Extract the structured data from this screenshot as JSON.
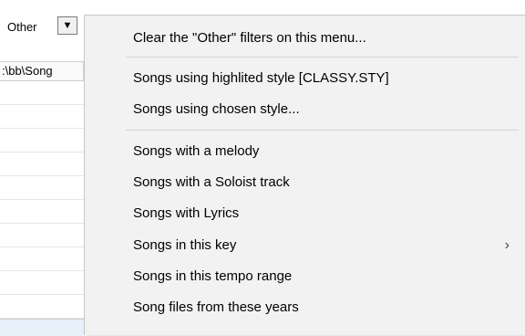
{
  "background": {
    "label": "Other",
    "dropdown_glyph": "▼",
    "path_text": ":\\bb\\Song"
  },
  "menu": {
    "items": [
      {
        "label": "Clear the \"Other\" filters on this menu..."
      },
      {
        "label": "Songs using highlited style  [CLASSY.STY]"
      },
      {
        "label": "Songs using chosen style..."
      },
      {
        "label": "Songs with a melody"
      },
      {
        "label": "Songs with a Soloist track"
      },
      {
        "label": "Songs with Lyrics"
      },
      {
        "label": "Songs in this key",
        "submenu": true
      },
      {
        "label": "Songs in this tempo range"
      },
      {
        "label": "Song files from these years"
      }
    ],
    "submenu_glyph": "›"
  }
}
